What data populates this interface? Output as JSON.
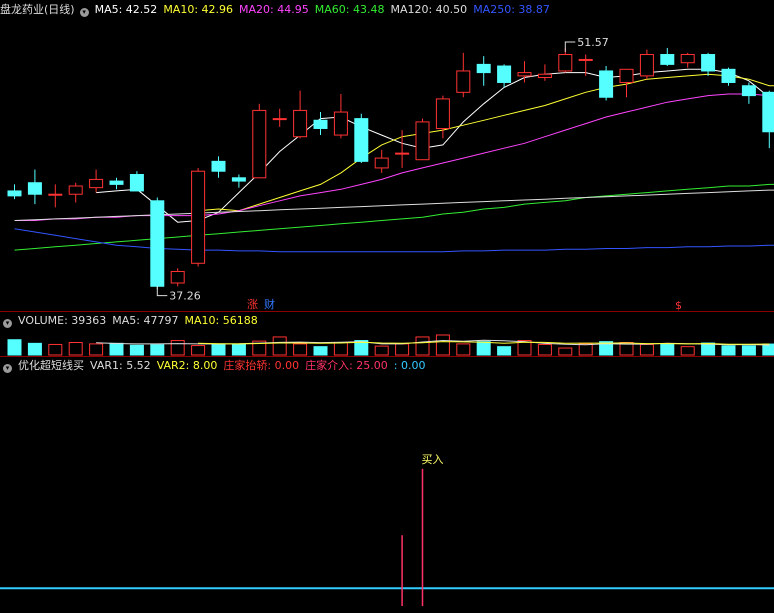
{
  "header": {
    "title": "盘龙药业(日线)",
    "ma_items": [
      {
        "text": "MA5: 42.52",
        "color": "#ffffff"
      },
      {
        "text": "MA10: 42.96",
        "color": "#ffff33"
      },
      {
        "text": "MA20: 44.95",
        "color": "#ff44ff"
      },
      {
        "text": "MA60: 43.48",
        "color": "#33ee33"
      },
      {
        "text": "MA120: 40.50",
        "color": "#dddddd"
      },
      {
        "text": "MA250: 38.87",
        "color": "#3355ff"
      }
    ]
  },
  "volume_header": {
    "items": [
      {
        "text": "VOLUME: 39363",
        "color": "#dddddd"
      },
      {
        "text": "MA5: 47797",
        "color": "#dddddd"
      },
      {
        "text": "MA10: 56188",
        "color": "#ffff33"
      }
    ]
  },
  "indicator_header": {
    "items": [
      {
        "text": "优化超短线买",
        "color": "#dddddd"
      },
      {
        "text": "VAR1: 5.52",
        "color": "#dddddd"
      },
      {
        "text": "VAR2: 8.00",
        "color": "#ffff33"
      },
      {
        "text": "庄家抬轿: 0.00",
        "color": "#ff3333"
      },
      {
        "text": "庄家介入: 25.00",
        "color": "#ff3366"
      },
      {
        "text": ": 0.00",
        "color": "#33ccff"
      }
    ]
  },
  "markers": {
    "zhang": "涨",
    "cai": "财",
    "dollar": "$"
  },
  "annotations": {
    "high": "51.57",
    "low": "37.26",
    "buy": "买入"
  },
  "colors": {
    "up": "#ff3333",
    "down": "#55ffff",
    "separator": "#8b0000"
  },
  "chart_data": [
    {
      "type": "candlestick",
      "title": "盘龙药业(日线)",
      "ylim": [
        36.2,
        53.6
      ],
      "candles": [
        {
          "o": 43.2,
          "h": 43.6,
          "l": 42.7,
          "c": 42.9
        },
        {
          "o": 43.7,
          "h": 44.5,
          "l": 42.4,
          "c": 43.0
        },
        {
          "o": 43.0,
          "h": 43.6,
          "l": 42.2,
          "c": 43.0
        },
        {
          "o": 43.0,
          "h": 43.7,
          "l": 42.5,
          "c": 43.5
        },
        {
          "o": 43.4,
          "h": 44.5,
          "l": 43.1,
          "c": 43.9
        },
        {
          "o": 43.8,
          "h": 44.0,
          "l": 43.3,
          "c": 43.6
        },
        {
          "o": 44.2,
          "h": 44.4,
          "l": 43.2,
          "c": 43.2
        },
        {
          "o": 42.6,
          "h": 42.8,
          "l": 37.2,
          "c": 37.4
        },
        {
          "o": 37.6,
          "h": 38.5,
          "l": 37.4,
          "c": 38.3
        },
        {
          "o": 38.8,
          "h": 44.6,
          "l": 38.6,
          "c": 44.4
        },
        {
          "o": 45.0,
          "h": 45.3,
          "l": 44.0,
          "c": 44.4
        },
        {
          "o": 44.0,
          "h": 44.2,
          "l": 43.4,
          "c": 43.8
        },
        {
          "o": 44.0,
          "h": 48.5,
          "l": 44.0,
          "c": 48.1
        },
        {
          "o": 47.6,
          "h": 48.2,
          "l": 47.1,
          "c": 47.6
        },
        {
          "o": 46.5,
          "h": 49.3,
          "l": 46.4,
          "c": 48.1
        },
        {
          "o": 47.5,
          "h": 48.0,
          "l": 46.6,
          "c": 47.0
        },
        {
          "o": 46.6,
          "h": 49.1,
          "l": 46.4,
          "c": 48.0
        },
        {
          "o": 47.6,
          "h": 47.9,
          "l": 44.9,
          "c": 45.0
        },
        {
          "o": 44.6,
          "h": 45.7,
          "l": 44.3,
          "c": 45.2
        },
        {
          "o": 45.5,
          "h": 46.9,
          "l": 44.6,
          "c": 45.5
        },
        {
          "o": 45.1,
          "h": 47.6,
          "l": 45.1,
          "c": 47.4
        },
        {
          "o": 47.0,
          "h": 49.0,
          "l": 46.4,
          "c": 48.8
        },
        {
          "o": 49.2,
          "h": 51.6,
          "l": 48.9,
          "c": 50.5
        },
        {
          "o": 50.9,
          "h": 51.4,
          "l": 49.6,
          "c": 50.4
        },
        {
          "o": 50.8,
          "h": 50.9,
          "l": 49.5,
          "c": 49.8
        },
        {
          "o": 50.2,
          "h": 51.1,
          "l": 49.8,
          "c": 50.4
        },
        {
          "o": 50.1,
          "h": 50.9,
          "l": 49.9,
          "c": 50.3
        },
        {
          "o": 50.5,
          "h": 51.9,
          "l": 50.4,
          "c": 51.5
        },
        {
          "o": 51.2,
          "h": 51.5,
          "l": 50.2,
          "c": 51.2
        },
        {
          "o": 50.5,
          "h": 50.8,
          "l": 48.7,
          "c": 48.9
        },
        {
          "o": 49.8,
          "h": 50.6,
          "l": 48.9,
          "c": 50.6
        },
        {
          "o": 50.2,
          "h": 51.8,
          "l": 50.0,
          "c": 51.5
        },
        {
          "o": 51.5,
          "h": 51.9,
          "l": 50.8,
          "c": 50.9
        },
        {
          "o": 51.0,
          "h": 51.6,
          "l": 50.7,
          "c": 51.5
        },
        {
          "o": 51.5,
          "h": 51.6,
          "l": 50.2,
          "c": 50.5
        },
        {
          "o": 50.6,
          "h": 50.7,
          "l": 49.6,
          "c": 49.8
        },
        {
          "o": 49.6,
          "h": 49.8,
          "l": 48.5,
          "c": 49.0
        },
        {
          "o": 49.2,
          "h": 49.3,
          "l": 45.8,
          "c": 46.8
        }
      ],
      "ma_lines": [
        {
          "name": "MA5",
          "color": "#ffffff",
          "values": [
            null,
            null,
            null,
            null,
            43.1,
            43.2,
            43.3,
            42.3,
            41.3,
            41.4,
            41.9,
            43.1,
            44.3,
            45.6,
            46.6,
            47.6,
            47.7,
            47.1,
            46.6,
            46.1,
            45.8,
            46.0,
            47.4,
            48.5,
            49.5,
            50.1,
            50.3,
            50.4,
            50.4,
            50.1,
            50.2,
            50.4,
            50.5,
            50.6,
            50.6,
            50.4,
            49.9,
            48.9
          ]
        },
        {
          "name": "MA10",
          "color": "#ffff33",
          "values": [
            null,
            null,
            null,
            null,
            null,
            null,
            null,
            null,
            null,
            42.0,
            42.1,
            42.0,
            42.4,
            42.8,
            43.2,
            43.6,
            44.3,
            45.2,
            46.0,
            46.5,
            46.7,
            46.9,
            47.2,
            47.5,
            47.8,
            48.1,
            48.4,
            48.8,
            49.2,
            49.5,
            49.7,
            50.0,
            50.1,
            50.2,
            50.3,
            50.2,
            50.0,
            49.6
          ]
        },
        {
          "name": "MA20",
          "color": "#ff44ff",
          "values": [
            41.4,
            41.4,
            41.5,
            41.5,
            41.6,
            41.6,
            41.7,
            41.7,
            41.7,
            41.7,
            41.8,
            42.0,
            42.3,
            42.6,
            42.9,
            43.1,
            43.3,
            43.6,
            43.9,
            44.3,
            44.6,
            44.9,
            45.2,
            45.5,
            45.8,
            46.1,
            46.5,
            46.9,
            47.3,
            47.7,
            48.0,
            48.3,
            48.6,
            48.8,
            49.0,
            49.1,
            49.1,
            49.0
          ]
        },
        {
          "name": "MA60",
          "color": "#33ee33",
          "values": [
            39.6,
            39.7,
            39.8,
            39.9,
            40.0,
            40.1,
            40.2,
            40.3,
            40.4,
            40.5,
            40.6,
            40.7,
            40.8,
            40.9,
            41.0,
            41.1,
            41.2,
            41.3,
            41.4,
            41.5,
            41.6,
            41.8,
            41.9,
            42.1,
            42.2,
            42.4,
            42.5,
            42.6,
            42.8,
            42.9,
            43.0,
            43.1,
            43.2,
            43.3,
            43.4,
            43.5,
            43.5,
            43.6
          ]
        },
        {
          "name": "MA120",
          "color": "#dddddd",
          "values": [
            41.4,
            41.45,
            41.5,
            41.55,
            41.6,
            41.65,
            41.7,
            41.75,
            41.8,
            41.85,
            41.9,
            41.95,
            42.0,
            42.05,
            42.1,
            42.15,
            42.2,
            42.25,
            42.3,
            42.35,
            42.4,
            42.45,
            42.5,
            42.55,
            42.6,
            42.65,
            42.7,
            42.75,
            42.8,
            42.85,
            42.9,
            42.95,
            43.0,
            43.05,
            43.1,
            43.15,
            43.2,
            43.25
          ]
        },
        {
          "name": "MA250",
          "color": "#3355ff",
          "values": [
            40.9,
            40.7,
            40.5,
            40.3,
            40.1,
            39.9,
            39.8,
            39.7,
            39.65,
            39.6,
            39.6,
            39.55,
            39.55,
            39.5,
            39.5,
            39.5,
            39.5,
            39.5,
            39.5,
            39.5,
            39.5,
            39.5,
            39.55,
            39.55,
            39.6,
            39.6,
            39.6,
            39.65,
            39.65,
            39.7,
            39.7,
            39.75,
            39.75,
            39.8,
            39.8,
            39.85,
            39.85,
            39.9
          ]
        }
      ]
    },
    {
      "type": "bar",
      "title": "VOLUME",
      "ylim": [
        0,
        90000
      ],
      "values": [
        55000,
        42000,
        38000,
        45000,
        40000,
        42000,
        35000,
        37000,
        52000,
        34000,
        40000,
        38000,
        50000,
        65000,
        40000,
        30000,
        45000,
        52000,
        32000,
        40000,
        65000,
        72000,
        40000,
        48000,
        30000,
        52000,
        38000,
        25000,
        40000,
        48000,
        45000,
        38000,
        40000,
        30000,
        43000,
        33000,
        33000,
        39363
      ],
      "ma_lines": [
        {
          "name": "MA5",
          "color": "#dddddd",
          "values": [
            null,
            null,
            null,
            null,
            44000,
            41400,
            40000,
            39800,
            41200,
            40000,
            39600,
            40200,
            42800,
            45400,
            46600,
            44600,
            46000,
            48400,
            39800,
            39800,
            46800,
            52200,
            49800,
            53400,
            51000,
            48400,
            41600,
            38600,
            37000,
            40600,
            39200,
            39200,
            42200,
            40200,
            39200,
            37000,
            37800,
            35672
          ]
        },
        {
          "name": "MA10",
          "color": "#ffff33",
          "values": [
            null,
            null,
            null,
            null,
            null,
            null,
            null,
            null,
            null,
            42000,
            40500,
            40100,
            41300,
            43300,
            43300,
            42100,
            43100,
            45600,
            43200,
            42600,
            44200,
            48200,
            47300,
            46100,
            42300,
            46100,
            45400,
            42100,
            42800,
            42800,
            43600,
            41200,
            41000,
            39900,
            41300,
            38900,
            38400,
            39736
          ]
        }
      ]
    },
    {
      "type": "bar",
      "title": "优化超短线买",
      "series": [
        {
          "name": "VAR1",
          "values": [
            4,
            4,
            4,
            4,
            4,
            4,
            4,
            4,
            4,
            4,
            4,
            4,
            4,
            4,
            4,
            4,
            4,
            4,
            4,
            4,
            4,
            4,
            4,
            4,
            4,
            4,
            4,
            4,
            4,
            4,
            4,
            4,
            4,
            4,
            4,
            4,
            4,
            5.52
          ]
        }
      ],
      "signals": [
        {
          "index": 19,
          "value": 16,
          "color": "#ff3366"
        },
        {
          "index": 20,
          "value": 31,
          "color": "#ff3366"
        }
      ],
      "ylim": [
        0,
        52
      ]
    }
  ]
}
